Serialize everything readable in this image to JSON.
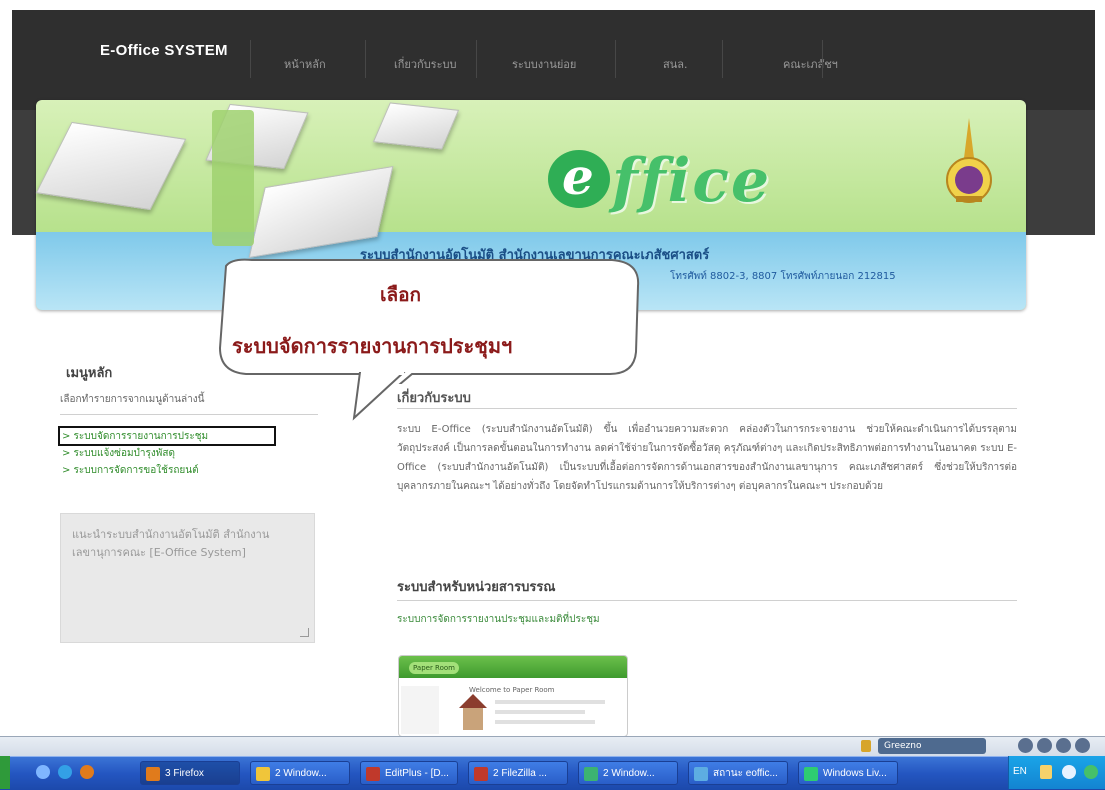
{
  "header": {
    "brand": "E-Office SYSTEM",
    "nav": [
      "หน้าหลัก",
      "เกี่ยวกับระบบ",
      "ระบบงานย่อย",
      "สนล.",
      "คณะเภสัชฯ"
    ]
  },
  "banner": {
    "logo": "ffice",
    "logo_e": "e",
    "department": "ระบบสำนักงานอัตโนมัติ สำนักงานเลขานุการคณะเภสัชศาสตร์",
    "phone": "โทรศัพท์ 8802-3, 8807 โทรศัพท์ภายนอก 212815"
  },
  "callout": {
    "title": "เลือก",
    "text": "ระบบจัดการรายงานการประชุมฯ"
  },
  "sidebar": {
    "title": "เมนูหลัก",
    "description": "เลือกทำรายการจากเมนูด้านล่างนี้",
    "links": [
      "> ระบบจัดการรายงานการประชุม",
      "> ระบบแจ้งซ่อมบำรุงพัสดุ",
      "> ระบบการจัดการขอใช้รถยนต์"
    ],
    "box_text": "แนะนำระบบสำนักงานอัตโนมัติ สำนักงานเลขานุการคณะ [E-Office System]"
  },
  "main": {
    "heading": "เกี่ยวกับระบบ",
    "paragraph": "ระบบ E-Office (ระบบสำนักงานอัตโนมัติ) ขึ้น เพื่ออำนวยความสะดวก คล่องตัวในการกระจายงาน ช่วยให้คณะดำเนินการได้บรรลุตามวัตถุประสงค์ เป็นการลดขั้นตอนในการทำงาน ลดค่าใช้จ่ายในการจัดซื้อวัสดุ ครุภัณฑ์ต่างๆ และเกิดประสิทธิภาพต่อการทำงานในอนาคต ระบบ E-Office (ระบบสำนักงานอัตโนมัติ) เป็นระบบที่เอื้อต่อการจัดการด้านเอกสารของสำนักงานเลขานุการ คณะเภสัชศาสตร์ ซึ่งช่วยให้บริการต่อบุคลากรภายในคณะฯ ได้อย่างทั่วถึง โดยจัดทำโปรแกรมด้านการให้บริการต่างๆ ต่อบุคลากรในคณะฯ ประกอบด้วย",
    "subheading": "ระบบสำหรับหน่วยสารบรรณ",
    "link": "ระบบการจัดการรายงานประชุมและมติที่ประชุม",
    "thumb_pill": "Paper Room",
    "thumb_title": "Welcome to Paper Room"
  },
  "statusbar": {
    "greeno": "Greezno"
  },
  "taskbar": {
    "tasks": [
      {
        "label": "3 Firefox",
        "color": "#e07b1c"
      },
      {
        "label": "2 Window...",
        "color": "#f0c53a"
      },
      {
        "label": "EditPlus - [D...",
        "color": "#c0392b"
      },
      {
        "label": "2 FileZilla ...",
        "color": "#c0392b"
      },
      {
        "label": "2 Window...",
        "color": "#3cb371"
      },
      {
        "label": "สถานะ eoffic...",
        "color": "#5dade2"
      },
      {
        "label": "Windows Liv...",
        "color": "#2ecc71"
      }
    ],
    "lang": "EN"
  }
}
